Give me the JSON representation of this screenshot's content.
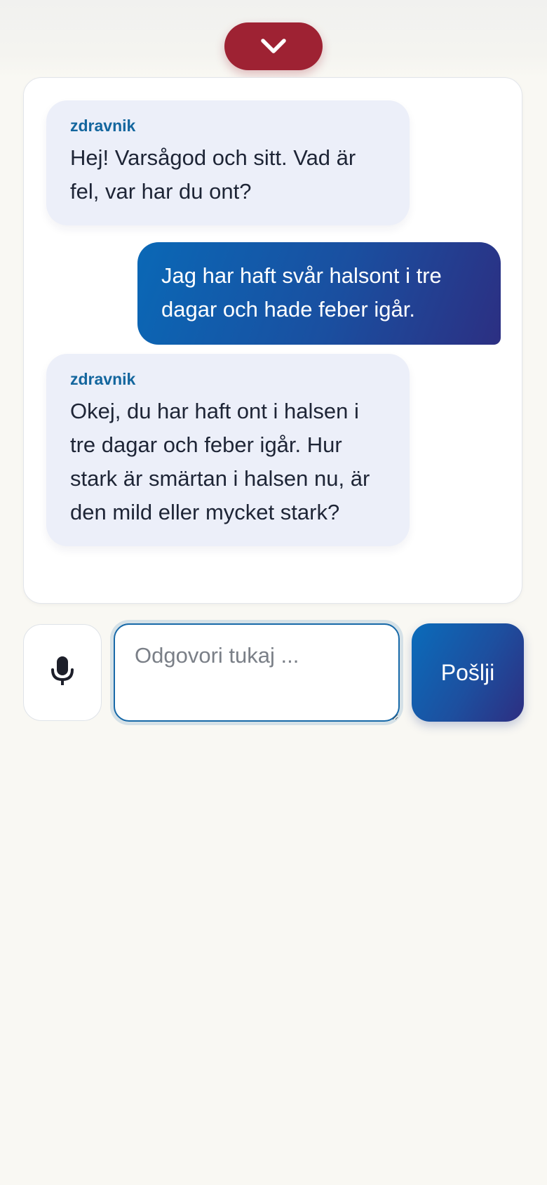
{
  "header": {
    "collapse_icon": "chevron-down-icon",
    "accent_color": "#9e2233"
  },
  "chat": {
    "messages": [
      {
        "role": "bot",
        "sender": "zdravnik",
        "text": "Hej! Varsågod och sitt. Vad är fel, var har du ont?"
      },
      {
        "role": "user",
        "text": "Jag har haft svår halsont i tre dagar och hade feber igår."
      },
      {
        "role": "bot",
        "sender": "zdravnik",
        "text": "Okej, du har haft ont i halsen i tre dagar och feber igår. Hur stark är smärtan i halsen nu, är den mild eller mycket stark?"
      }
    ]
  },
  "composer": {
    "mic_icon": "microphone-icon",
    "placeholder": "Odgovori tukaj ...",
    "value": "",
    "send_label": "Pošlji"
  },
  "colors": {
    "bot_bubble": "#eceff9",
    "sender_name": "#13669e",
    "user_bubble_start": "#0a68b6",
    "user_bubble_end": "#2c2f82",
    "page_background": "#f9f8f3"
  }
}
